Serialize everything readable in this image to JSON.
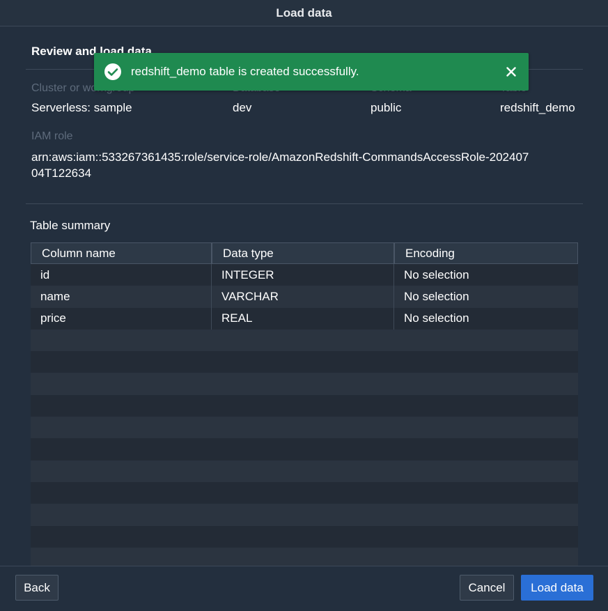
{
  "dialog": {
    "title": "Load data"
  },
  "review": {
    "heading": "Review and load data",
    "fields": [
      {
        "label": "Cluster or workgroup",
        "value": "Serverless: sample"
      },
      {
        "label": "Database",
        "value": "dev"
      },
      {
        "label": "Schema",
        "value": "public"
      },
      {
        "label": "Table",
        "value": "redshift_demo"
      }
    ],
    "iam": {
      "label": "IAM role",
      "value": "arn:aws:iam::533267361435:role/service-role/AmazonRedshift-CommandsAccessRole-20240704T122634"
    }
  },
  "toast": {
    "message": "redshift_demo table is created successfully.",
    "icon": "check-circle-icon",
    "close_icon": "close-icon",
    "color": "#1f8a50"
  },
  "summary": {
    "label": "Table summary",
    "columns": [
      "Column name",
      "Data type",
      "Encoding"
    ],
    "rows": [
      [
        "id",
        "INTEGER",
        "No selection"
      ],
      [
        "name",
        "VARCHAR",
        "No selection"
      ],
      [
        "price",
        "REAL",
        "No selection"
      ]
    ]
  },
  "footer": {
    "back_label": "Back",
    "cancel_label": "Cancel",
    "load_label": "Load data"
  },
  "colors": {
    "background": "#232f3e",
    "primary_button": "#2a6fd6",
    "toast": "#1f8a50"
  }
}
